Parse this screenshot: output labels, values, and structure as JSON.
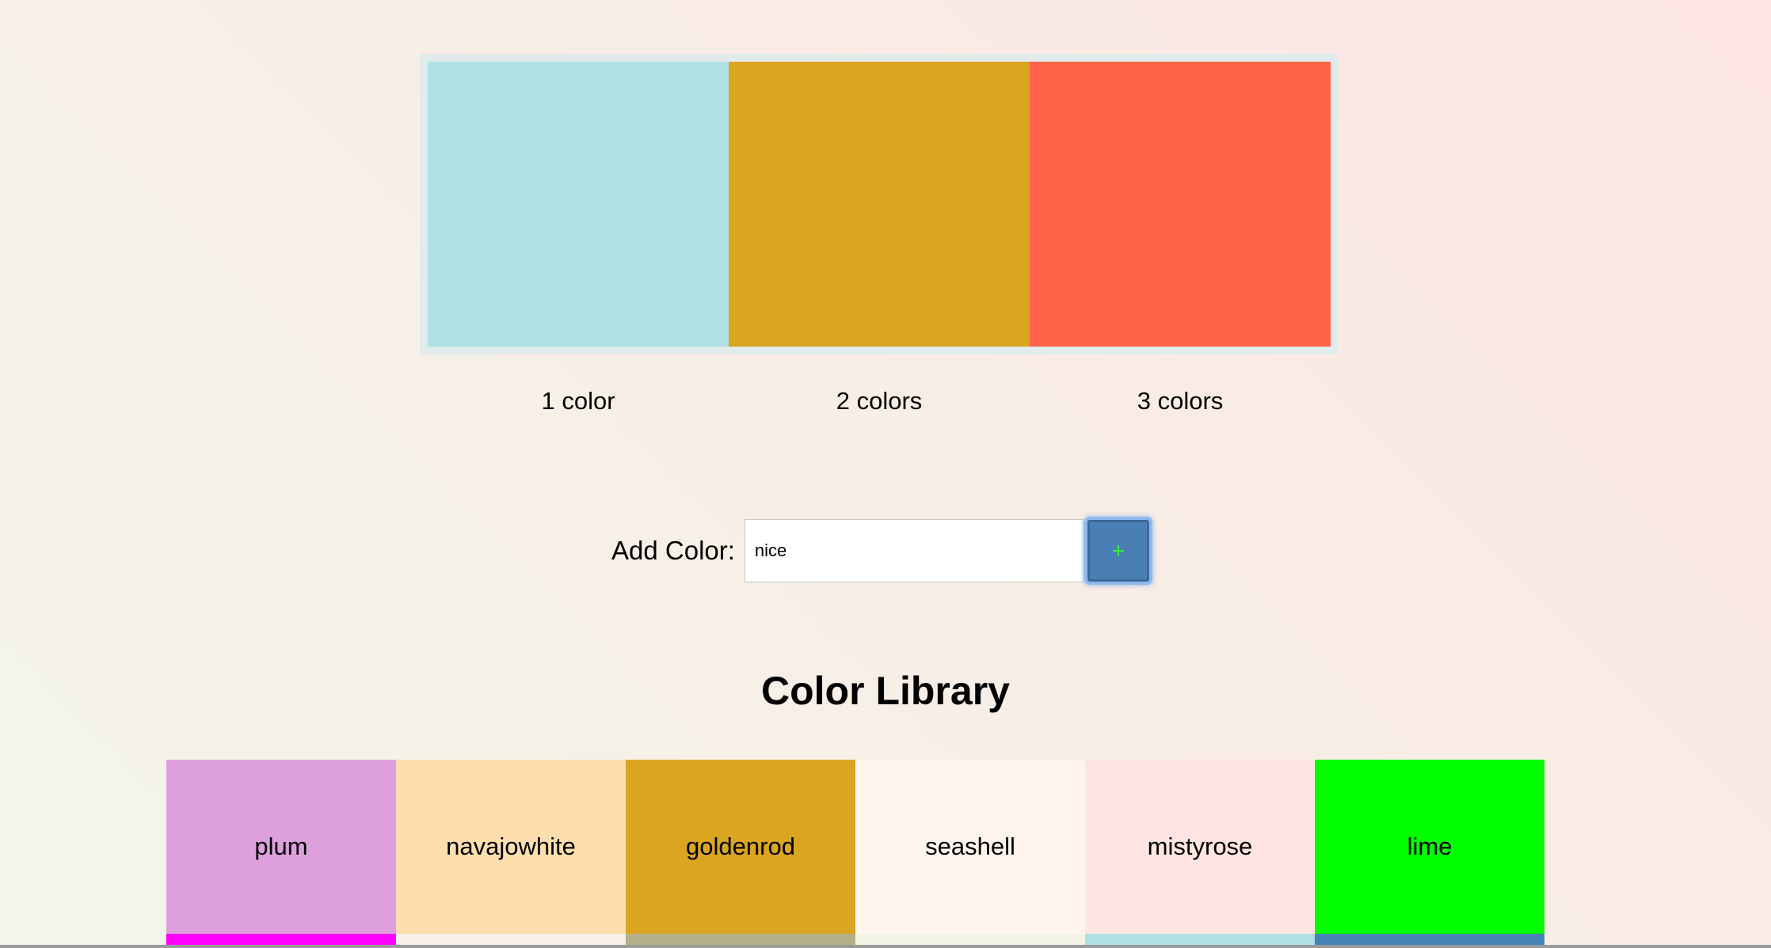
{
  "palette": {
    "swatches": [
      {
        "color": "#b0e0e6",
        "label": "1 color"
      },
      {
        "color": "#daa520",
        "label": "2 colors"
      },
      {
        "color": "#ff6347",
        "label": "3 colors"
      }
    ]
  },
  "add_color": {
    "label": "Add Color:",
    "input_value": "nice",
    "button_label": "+"
  },
  "library": {
    "title": "Color Library",
    "tiles": [
      {
        "name": "plum",
        "color": "#dda0dd"
      },
      {
        "name": "navajowhite",
        "color": "#ffdead"
      },
      {
        "name": "goldenrod",
        "color": "#daa520"
      },
      {
        "name": "seashell",
        "color": "#fff5ee"
      },
      {
        "name": "mistyrose",
        "color": "#ffe4e1"
      },
      {
        "name": "lime",
        "color": "#00ff00"
      }
    ],
    "next_row_colors": [
      "#ff00ff",
      "#f8f0e8",
      "#b5b08a",
      "#f3f3e4",
      "#b0e0e6",
      "#4682b4"
    ]
  }
}
